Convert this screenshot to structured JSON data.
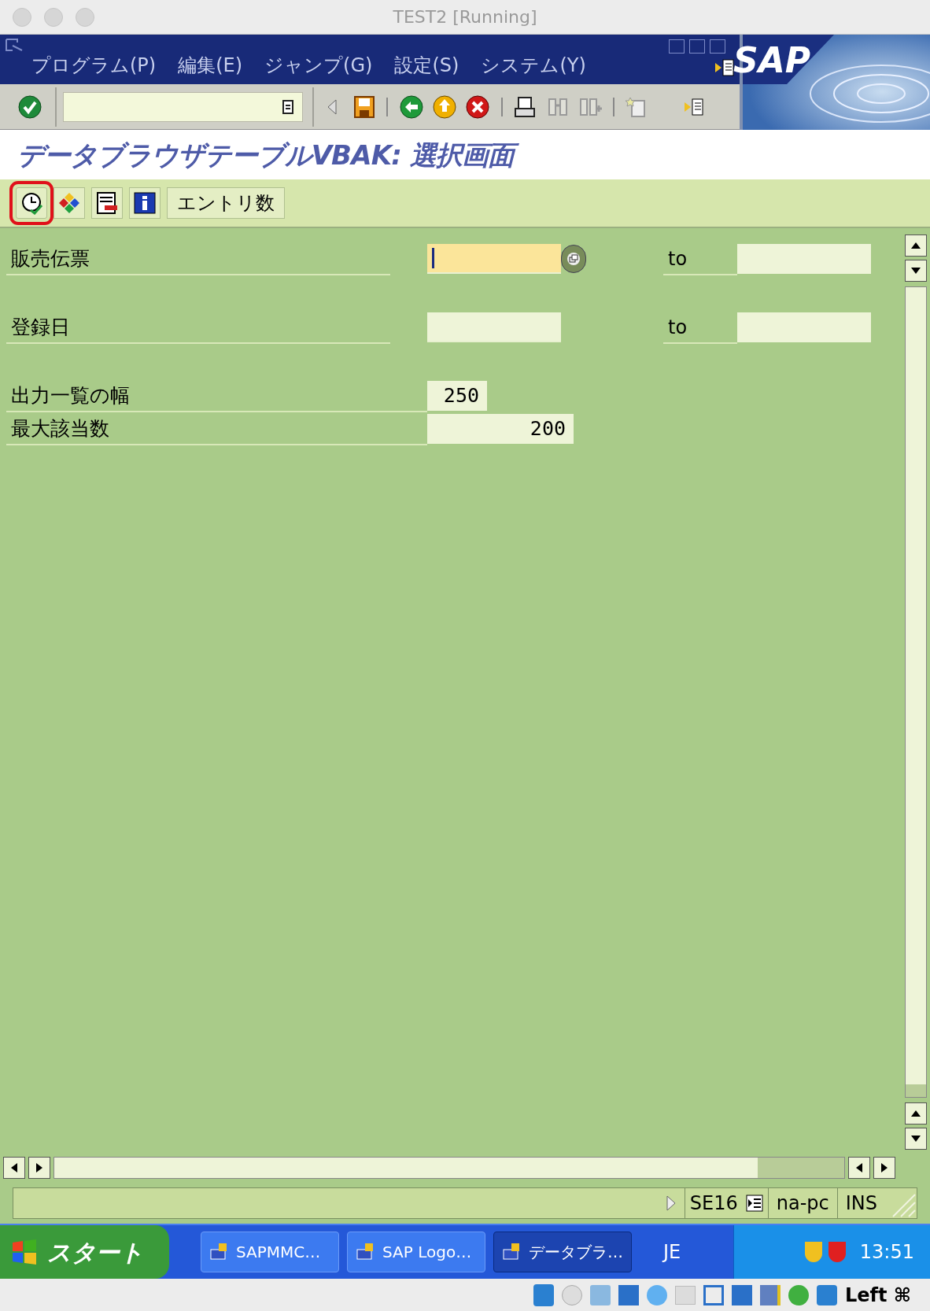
{
  "window": {
    "title": "TEST2 [Running]"
  },
  "menu": [
    {
      "label": "プログラム(P)"
    },
    {
      "label": "編集(E)"
    },
    {
      "label": "ジャンプ(G)"
    },
    {
      "label": "設定(S)"
    },
    {
      "label": "システム(Y)"
    }
  ],
  "screen_title": "データブラウザテーブルVBAK: 選択画面",
  "app_toolbar": [
    {
      "kind": "execute",
      "highlighted": true
    },
    {
      "kind": "options",
      "highlighted": false
    },
    {
      "kind": "layout",
      "highlighted": false
    },
    {
      "kind": "info",
      "highlighted": false
    },
    {
      "kind": "text",
      "label": "エントリ数",
      "highlighted": false
    }
  ],
  "fields": [
    {
      "kind": "range",
      "label": "販売伝票",
      "to_label": "to",
      "focused": true
    },
    {
      "kind": "range",
      "label": "登録日",
      "to_label": "to",
      "focused": false
    },
    {
      "kind": "short",
      "label": "出力一覧の幅",
      "value": "250"
    },
    {
      "kind": "value",
      "label": "最大該当数",
      "value": "200"
    }
  ],
  "status_bar": {
    "transaction": "SE16",
    "system": "na-pc",
    "mode": "INS"
  },
  "taskbar": {
    "start": "スタート",
    "tasks": [
      {
        "label": "SAPMMC…",
        "selected": false
      },
      {
        "label": "SAP Logo…",
        "selected": false
      },
      {
        "label": "データブラ…",
        "selected": true
      }
    ],
    "language": "JE",
    "clock": "13:51"
  },
  "host_bar": {
    "key": "Left ⌘"
  },
  "logo": {
    "text": "SAP"
  }
}
